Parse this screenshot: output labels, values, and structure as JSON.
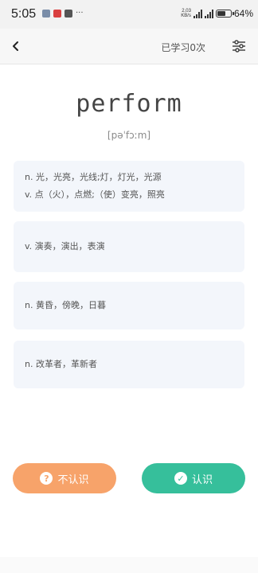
{
  "status_bar": {
    "time": "5:05",
    "icons": [
      "gallery-icon",
      "app-red-icon",
      "profile-icon"
    ],
    "more": "···",
    "network_speed_top": "2.03",
    "network_speed_bottom": "KB/s",
    "battery": "64%",
    "battery_level": 0.64
  },
  "header": {
    "learned_count": "已学习0次"
  },
  "word": {
    "text": "perform",
    "phonetic": "[pəˈfɔːm]"
  },
  "definitions": [
    {
      "lines": [
        "n. 光，光亮，光线;灯，灯光，光源",
        "v. 点（火），点燃;（使）变亮，照亮"
      ]
    },
    {
      "lines": [
        "v. 演奏，演出，表演"
      ]
    },
    {
      "lines": [
        "n. 黄昏，傍晚，日暮"
      ]
    },
    {
      "lines": [
        "n. 改革者，革新者"
      ]
    }
  ],
  "buttons": {
    "unknown_label": "不认识",
    "unknown_icon_glyph": "?",
    "known_label": "认识",
    "known_icon_glyph": "✓"
  },
  "colors": {
    "unknown_button": "#f7a36a",
    "known_button": "#36bf9b",
    "card_background": "#f3f6fb"
  }
}
